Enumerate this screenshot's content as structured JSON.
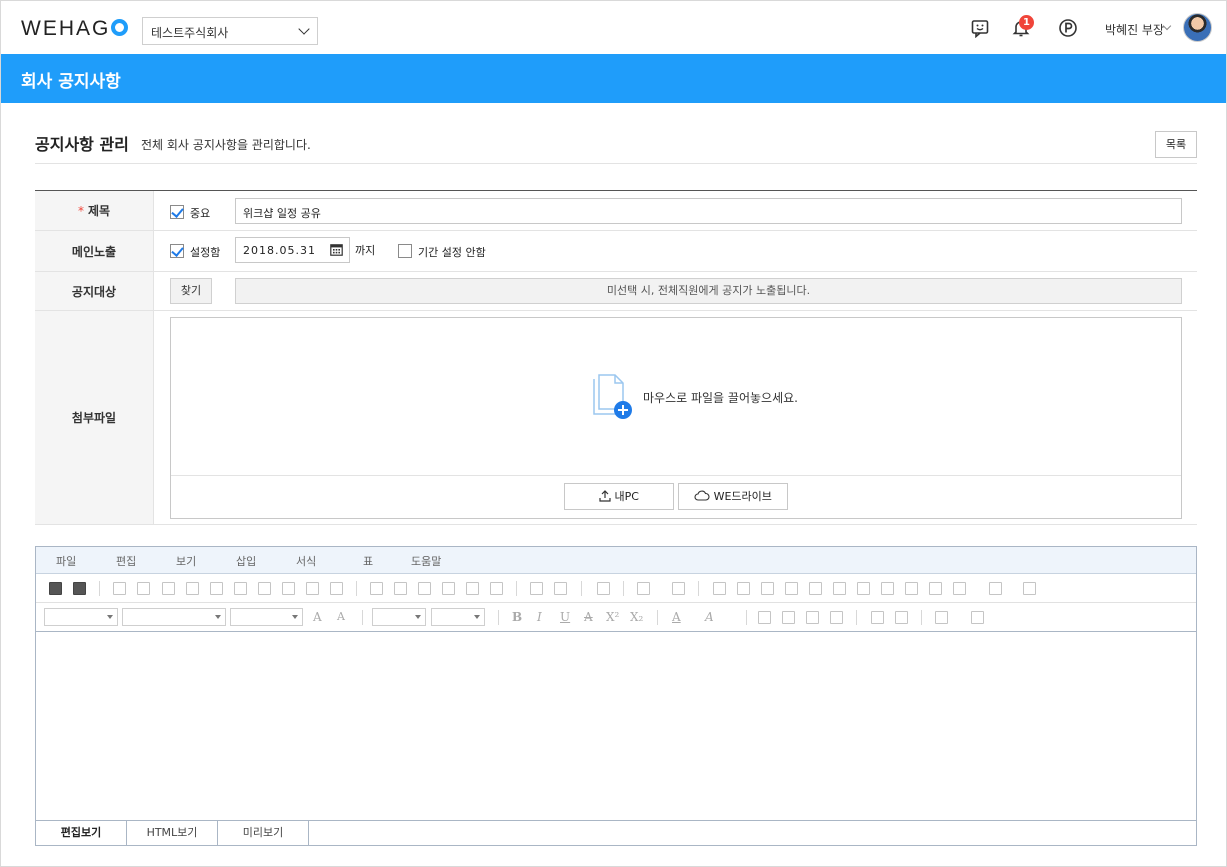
{
  "header": {
    "logo": "WEHAG",
    "company": "테스트주식회사",
    "notification_count": "1",
    "user_name": "박혜진 부장"
  },
  "banner": {
    "title": "회사 공지사항"
  },
  "page": {
    "title": "공지사항 관리",
    "description": "전체 회사 공지사항을 관리합니다.",
    "list_button": "목록"
  },
  "form": {
    "subject": {
      "label": "제목",
      "required_mark": "*",
      "important_label": "중요",
      "important_checked": true,
      "value": "위크샵 일정 공유"
    },
    "main_exposure": {
      "label": "메인노출",
      "set_label": "설정함",
      "set_checked": true,
      "date": "2018.05.31",
      "until": "까지",
      "no_period_label": "기간 설정 안함",
      "no_period_checked": false
    },
    "target": {
      "label": "공지대상",
      "find_button": "찾기",
      "placeholder": "미선택 시, 전체직원에게 공지가 노출됩니다."
    },
    "attachment": {
      "label": "첨부파일",
      "drop_text": "마우스로 파일을 끌어놓으세요.",
      "my_pc_button": "내PC",
      "we_drive_button": "WE드라이브"
    }
  },
  "editor": {
    "menu": [
      "파일",
      "편집",
      "보기",
      "삽입",
      "서식",
      "표",
      "도움말"
    ],
    "tabs": [
      "편집보기",
      "HTML보기",
      "미리보기"
    ],
    "active_tab": "편집보기"
  },
  "colors": {
    "accent": "#1f9dfa",
    "required": "#f0453a"
  }
}
